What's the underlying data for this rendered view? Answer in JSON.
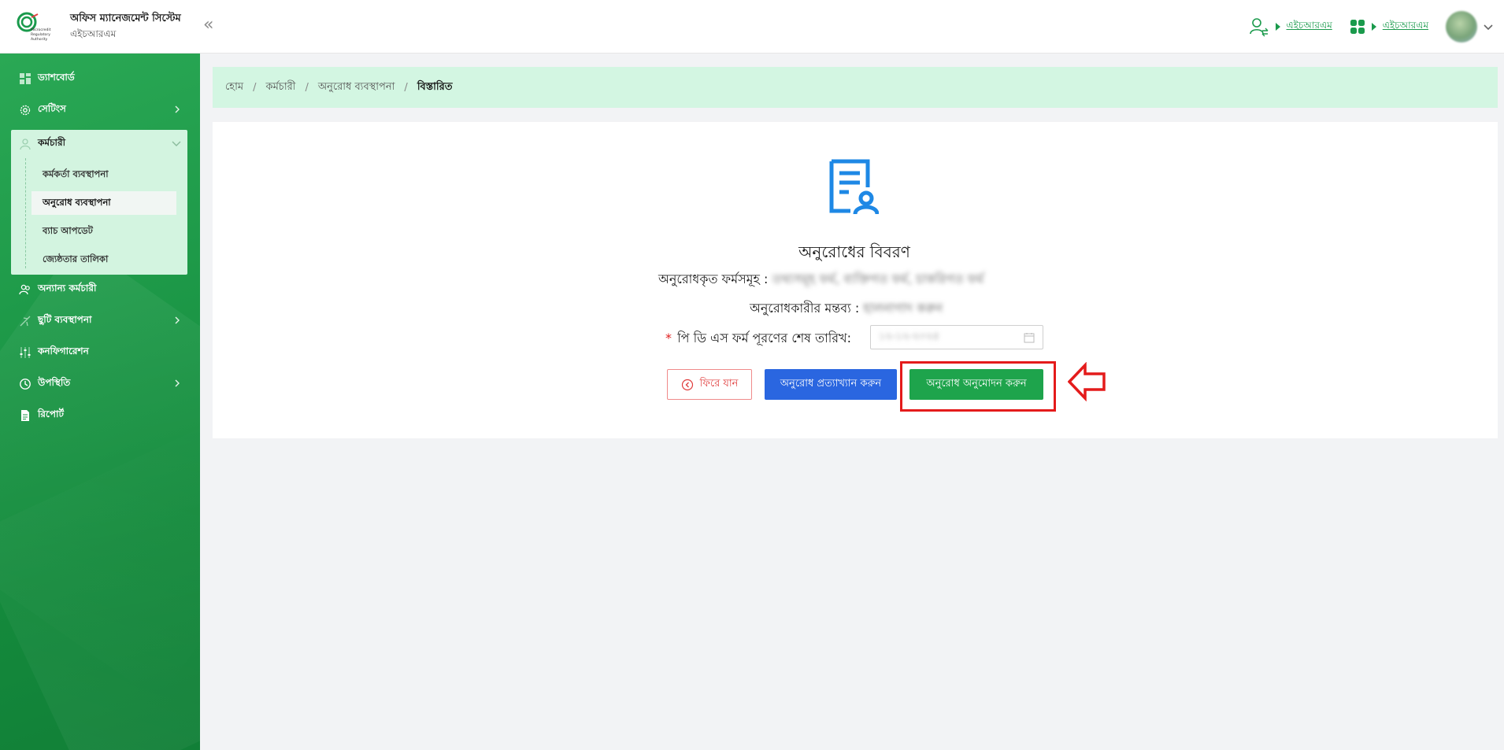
{
  "header": {
    "app_title": "অফিস ম্যানেজমেন্ট সিস্টেম",
    "app_subtitle": "এইচআরএম",
    "logo_text": [
      "Microcredit",
      "Regulatory",
      "Authority"
    ],
    "role_switch_1": "এইচআরএম",
    "role_switch_2": "এইচআরএম"
  },
  "sidebar": {
    "items": [
      {
        "label": "ড্যাশবোর্ড",
        "icon": "dashboard-icon"
      },
      {
        "label": "সেটিংস",
        "icon": "gear-icon"
      },
      {
        "label": "কর্মচারী",
        "icon": "users-icon"
      },
      {
        "label": "অন্যান্য কর্মচারী",
        "icon": "people-icon"
      },
      {
        "label": "ছুটি ব্যবস্থাপনা",
        "icon": "plane-icon"
      },
      {
        "label": "কনফিগারেশন",
        "icon": "sliders-icon"
      },
      {
        "label": "উপস্থিতি",
        "icon": "clock-icon"
      },
      {
        "label": "রিপোর্ট",
        "icon": "report-icon"
      }
    ],
    "employee_sub": [
      {
        "label": "কর্মকর্তা ব্যবস্থাপনা"
      },
      {
        "label": "অনুরোধ ব্যবস্থাপনা"
      },
      {
        "label": "ব্যাচ আপডেট"
      },
      {
        "label": "জ্যেষ্ঠতার তালিকা"
      }
    ]
  },
  "breadcrumb": {
    "home": "হোম",
    "employee": "কর্মচারী",
    "request_mgmt": "অনুরোধ ব্যবস্থাপনা",
    "current": "বিস্তারিত",
    "separator": "/"
  },
  "detail": {
    "title": "অনুরোধের বিবরণ",
    "forms_label": "অনুরোধকৃত ফর্মসমূহ :",
    "forms_value": "তথ্যসমূহ ফর্ম, ব্যক্তিগত ফর্ম, চাকরিগত ফর্ম",
    "comment_label": "অনুরোধকারীর মন্তব্য :",
    "comment_value": "হালনাগাদ করুন",
    "deadline_label": "পি ডি এস ফর্ম পূরণের শেষ তারিখ:",
    "required_mark": "*",
    "deadline_value": "১২-১২-২০২৫"
  },
  "actions": {
    "back": "ফিরে যান",
    "reject": "অনুরোধ প্রত্যাখ্যান করুন",
    "approve": "অনুরোধ অনুমোদন করুন"
  },
  "colors": {
    "brand_green": "#1ea44c",
    "reject_blue": "#2a66e0",
    "highlight_red": "#e41b1b"
  }
}
